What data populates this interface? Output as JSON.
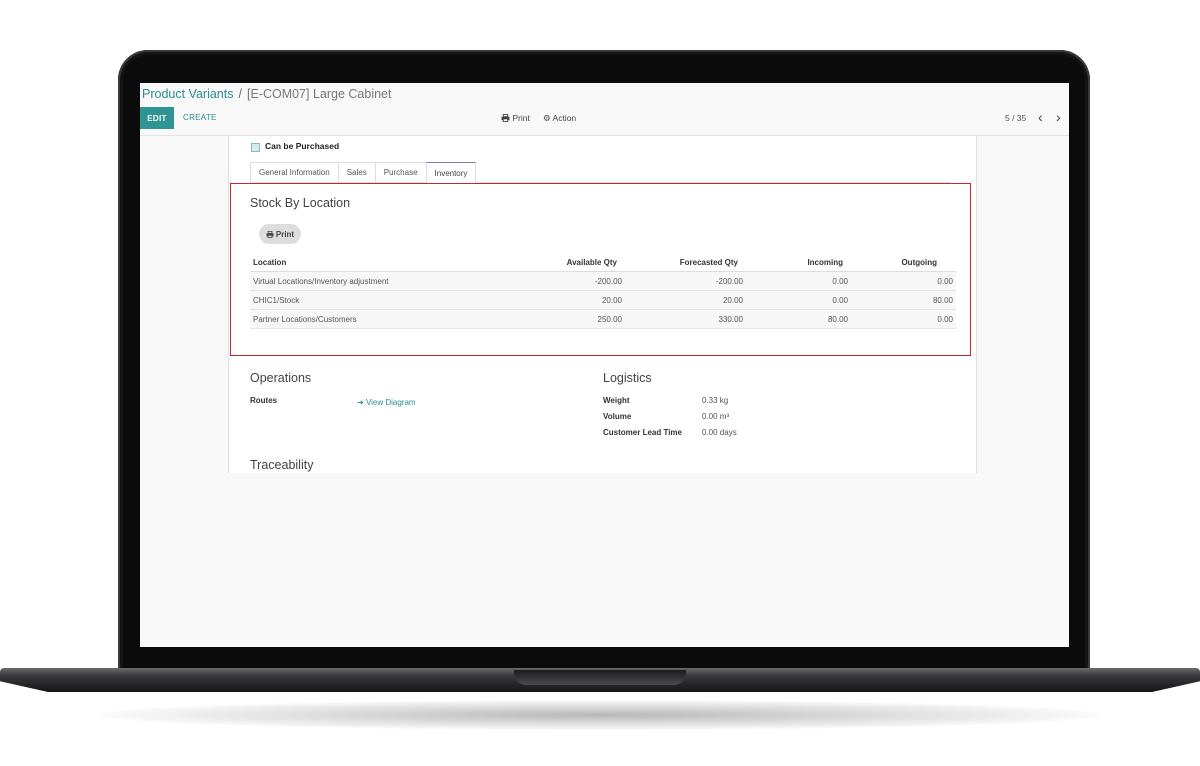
{
  "breadcrumb": {
    "parent": "Product Variants",
    "separator": "/",
    "current": "[E-COM07] Large Cabinet"
  },
  "control_panel": {
    "edit_label": "EDIT",
    "create_label": "CREATE",
    "print_label": "Print",
    "action_label": "Action",
    "pager": "5 / 35"
  },
  "form": {
    "can_be_purchased_label": "Can be Purchased",
    "tabs": [
      {
        "label": "General Information"
      },
      {
        "label": "Sales"
      },
      {
        "label": "Purchase"
      },
      {
        "label": "Inventory"
      }
    ],
    "active_tab": "Inventory",
    "stock": {
      "title": "Stock By Location",
      "print_button": "Print",
      "columns": [
        "Location",
        "Available Qty",
        "Forecasted Qty",
        "Incoming",
        "Outgoing"
      ],
      "rows": [
        {
          "location": "Virtual Locations/Inventory adjustment",
          "available": "-200.00",
          "forecasted": "-200.00",
          "incoming": "0.00",
          "outgoing": "0.00"
        },
        {
          "location": "CHIC1/Stock",
          "available": "20.00",
          "forecasted": "20.00",
          "incoming": "0.00",
          "outgoing": "80.00"
        },
        {
          "location": "Partner Locations/Customers",
          "available": "250.00",
          "forecasted": "330.00",
          "incoming": "80.00",
          "outgoing": "0.00"
        }
      ]
    },
    "operations": {
      "title": "Operations",
      "routes_label": "Routes",
      "view_diagram": "View Diagram"
    },
    "logistics": {
      "title": "Logistics",
      "weight_label": "Weight",
      "weight_value": "0.33 kg",
      "volume_label": "Volume",
      "volume_value": "0.00 m³",
      "lead_time_label": "Customer Lead Time",
      "lead_time_value": "0.00 days"
    },
    "traceability": {
      "title": "Traceability"
    }
  },
  "colors": {
    "accent": "#2f9494",
    "link": "#2c8d93",
    "highlight_border": "#c8242a"
  },
  "icons": {
    "print": "printer-icon",
    "action": "gear-icon",
    "prev": "chevron-left-icon",
    "next": "chevron-right-icon",
    "link": "arrow-right-icon"
  }
}
